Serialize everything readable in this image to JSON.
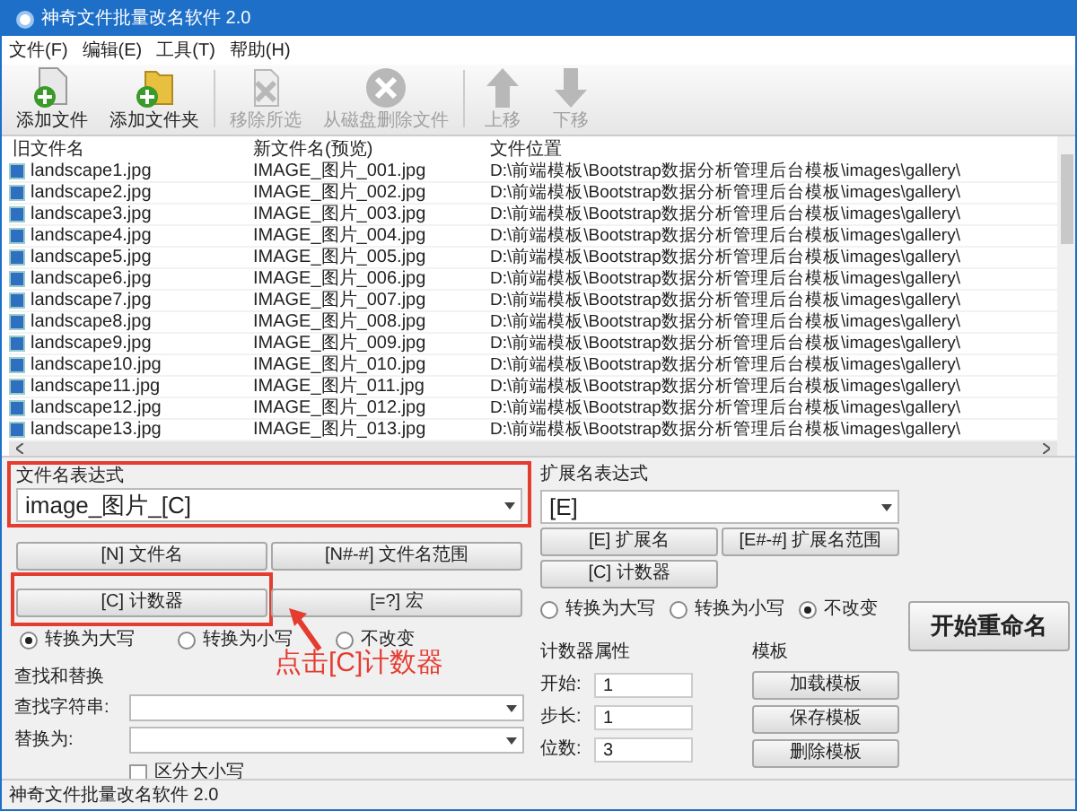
{
  "window": {
    "title": "神奇文件批量改名软件 2.0"
  },
  "menu": [
    "文件(F)",
    "编辑(E)",
    "工具(T)",
    "帮助(H)"
  ],
  "toolbar": [
    {
      "label": "添加文件",
      "kind": "add-file",
      "disabled": false
    },
    {
      "label": "添加文件夹",
      "kind": "add-folder",
      "disabled": false
    },
    {
      "label": "移除所选",
      "kind": "remove",
      "disabled": true
    },
    {
      "label": "从磁盘删除文件",
      "kind": "delete",
      "disabled": true
    },
    {
      "label": "上移",
      "kind": "up",
      "disabled": true
    },
    {
      "label": "下移",
      "kind": "down",
      "disabled": true
    }
  ],
  "table": {
    "columns": [
      "旧文件名",
      "新文件名(预览)",
      "文件位置"
    ],
    "rows": [
      [
        "landscape1.jpg",
        "IMAGE_图片_001.jpg",
        "D:\\前端模板\\Bootstrap数据分析管理后台模板\\images\\gallery\\"
      ],
      [
        "landscape2.jpg",
        "IMAGE_图片_002.jpg",
        "D:\\前端模板\\Bootstrap数据分析管理后台模板\\images\\gallery\\"
      ],
      [
        "landscape3.jpg",
        "IMAGE_图片_003.jpg",
        "D:\\前端模板\\Bootstrap数据分析管理后台模板\\images\\gallery\\"
      ],
      [
        "landscape4.jpg",
        "IMAGE_图片_004.jpg",
        "D:\\前端模板\\Bootstrap数据分析管理后台模板\\images\\gallery\\"
      ],
      [
        "landscape5.jpg",
        "IMAGE_图片_005.jpg",
        "D:\\前端模板\\Bootstrap数据分析管理后台模板\\images\\gallery\\"
      ],
      [
        "landscape6.jpg",
        "IMAGE_图片_006.jpg",
        "D:\\前端模板\\Bootstrap数据分析管理后台模板\\images\\gallery\\"
      ],
      [
        "landscape7.jpg",
        "IMAGE_图片_007.jpg",
        "D:\\前端模板\\Bootstrap数据分析管理后台模板\\images\\gallery\\"
      ],
      [
        "landscape8.jpg",
        "IMAGE_图片_008.jpg",
        "D:\\前端模板\\Bootstrap数据分析管理后台模板\\images\\gallery\\"
      ],
      [
        "landscape9.jpg",
        "IMAGE_图片_009.jpg",
        "D:\\前端模板\\Bootstrap数据分析管理后台模板\\images\\gallery\\"
      ],
      [
        "landscape10.jpg",
        "IMAGE_图片_010.jpg",
        "D:\\前端模板\\Bootstrap数据分析管理后台模板\\images\\gallery\\"
      ],
      [
        "landscape11.jpg",
        "IMAGE_图片_011.jpg",
        "D:\\前端模板\\Bootstrap数据分析管理后台模板\\images\\gallery\\"
      ],
      [
        "landscape12.jpg",
        "IMAGE_图片_012.jpg",
        "D:\\前端模板\\Bootstrap数据分析管理后台模板\\images\\gallery\\"
      ],
      [
        "landscape13.jpg",
        "IMAGE_图片_013.jpg",
        "D:\\前端模板\\Bootstrap数据分析管理后台模板\\images\\gallery\\"
      ]
    ]
  },
  "name_expression": {
    "label": "文件名表达式",
    "value": "image_图片_[C]",
    "buttons": [
      "[N] 文件名",
      "[N#-#] 文件名范围",
      "[C] 计数器",
      "[=?] 宏"
    ],
    "case_options": [
      {
        "label": "转换为大写",
        "selected": true
      },
      {
        "label": "转换为小写",
        "selected": false
      },
      {
        "label": "不改变",
        "selected": false
      }
    ]
  },
  "annotation": "点击[C]计数器",
  "extension_expression": {
    "label": "扩展名表达式",
    "value": "[E]",
    "buttons": [
      "[E] 扩展名",
      "[E#-#] 扩展名范围",
      "[C] 计数器"
    ],
    "case_options": [
      {
        "label": "转换为大写",
        "selected": false
      },
      {
        "label": "转换为小写",
        "selected": false
      },
      {
        "label": "不改变",
        "selected": true
      }
    ]
  },
  "start_button": "开始重命名",
  "find_replace": {
    "label": "查找和替换",
    "find_label": "查找字符串:",
    "replace_label": "替换为:",
    "case_sensitive": {
      "label": "区分大小写",
      "checked": false
    }
  },
  "counter": {
    "label": "计数器属性",
    "fields": [
      {
        "label": "开始:",
        "value": "1"
      },
      {
        "label": "步长:",
        "value": "1"
      },
      {
        "label": "位数:",
        "value": "3"
      }
    ]
  },
  "templates": {
    "label": "模板",
    "buttons": [
      "加载模板",
      "保存模板",
      "删除模板"
    ]
  },
  "status_bar": "神奇文件批量改名软件 2.0"
}
